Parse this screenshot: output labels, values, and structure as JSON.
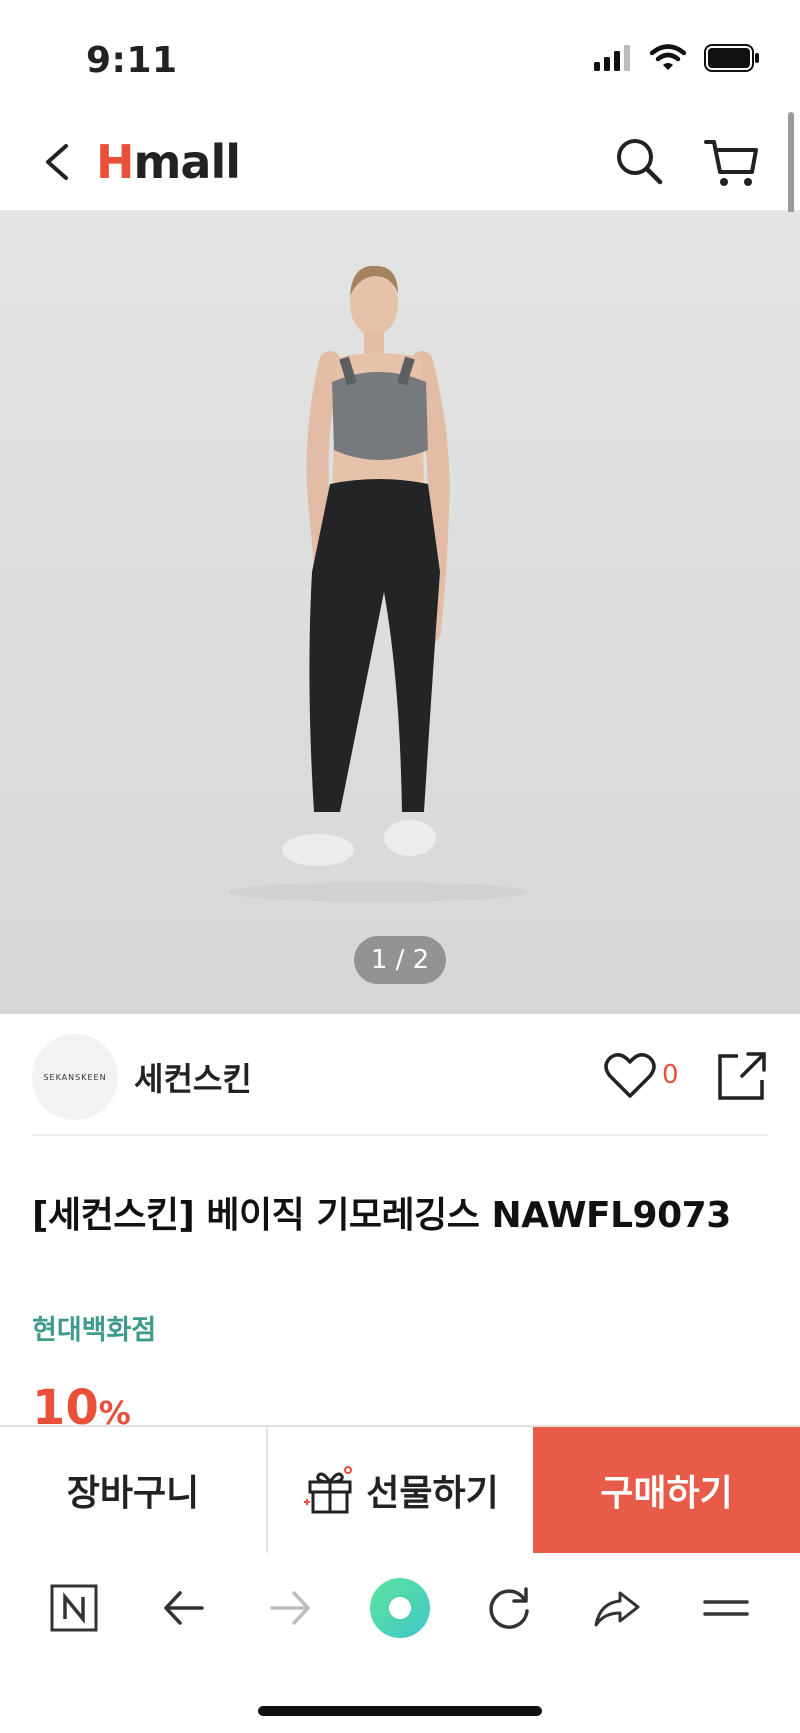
{
  "status_bar": {
    "time": "9:11"
  },
  "header": {
    "logo_h": "H",
    "logo_rest": "mall"
  },
  "gallery": {
    "counter": "1 / 2"
  },
  "brand": {
    "logo_text": "SEKANSKEEN",
    "name": "세컨스킨",
    "like_count": "0"
  },
  "product": {
    "title": "[세컨스킨] 베이직 기모레깅스 NAWFL9073",
    "seller": "현대백화점",
    "discount_value": "10",
    "discount_unit": "%"
  },
  "actions": {
    "cart": "장바구니",
    "gift": "선물하기",
    "buy": "구매하기"
  },
  "colors": {
    "accent": "#e8503a",
    "buy_bg": "#e85b48",
    "seller": "#3e9a8a"
  },
  "icons": [
    "back-icon",
    "search-icon",
    "cart-icon",
    "heart-icon",
    "share-icon",
    "gift-icon",
    "n-icon",
    "arrow-left-icon",
    "arrow-right-icon",
    "browser-home-icon",
    "refresh-icon",
    "forward-share-icon",
    "menu-icon"
  ]
}
